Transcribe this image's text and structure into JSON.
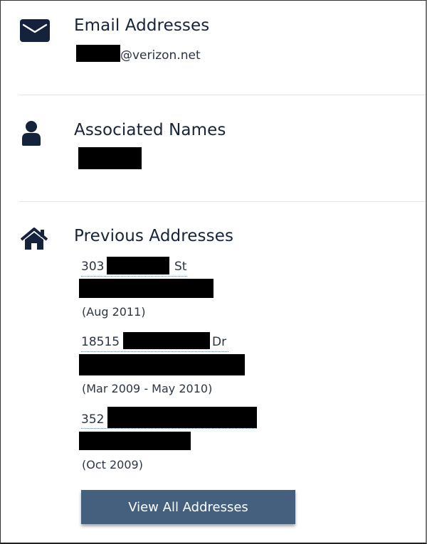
{
  "sections": {
    "email": {
      "icon": "envelope-icon",
      "title": "Email Addresses",
      "items": [
        {
          "local_part": "[redacted]",
          "domain": "@verizon.net"
        }
      ]
    },
    "names": {
      "icon": "user-icon",
      "title": "Associated Names",
      "items": [
        {
          "name": "[redacted]"
        }
      ]
    },
    "addresses": {
      "icon": "home-icon",
      "title": "Previous Addresses",
      "items": [
        {
          "number": "303",
          "street_suffix": "St",
          "street_redacted": "[redacted]",
          "city_line": "[redacted]",
          "dates": "(Aug 2011)"
        },
        {
          "number": "18515",
          "street_suffix": "Dr",
          "street_redacted": "[redacted]",
          "city_line": "[redacted]",
          "dates": "(Mar 2009 - May 2010)"
        },
        {
          "number": "352",
          "street_suffix": "",
          "street_redacted": "[redacted]",
          "city_line": "[redacted]",
          "dates": "(Oct 2009)"
        }
      ],
      "view_all_label": "View All Addresses"
    }
  },
  "colors": {
    "heading": "#172339",
    "icon": "#14233b",
    "button_bg": "#44607e",
    "button_text": "#ffffff",
    "divider": "#e4e4e4",
    "redaction": "#000000"
  }
}
